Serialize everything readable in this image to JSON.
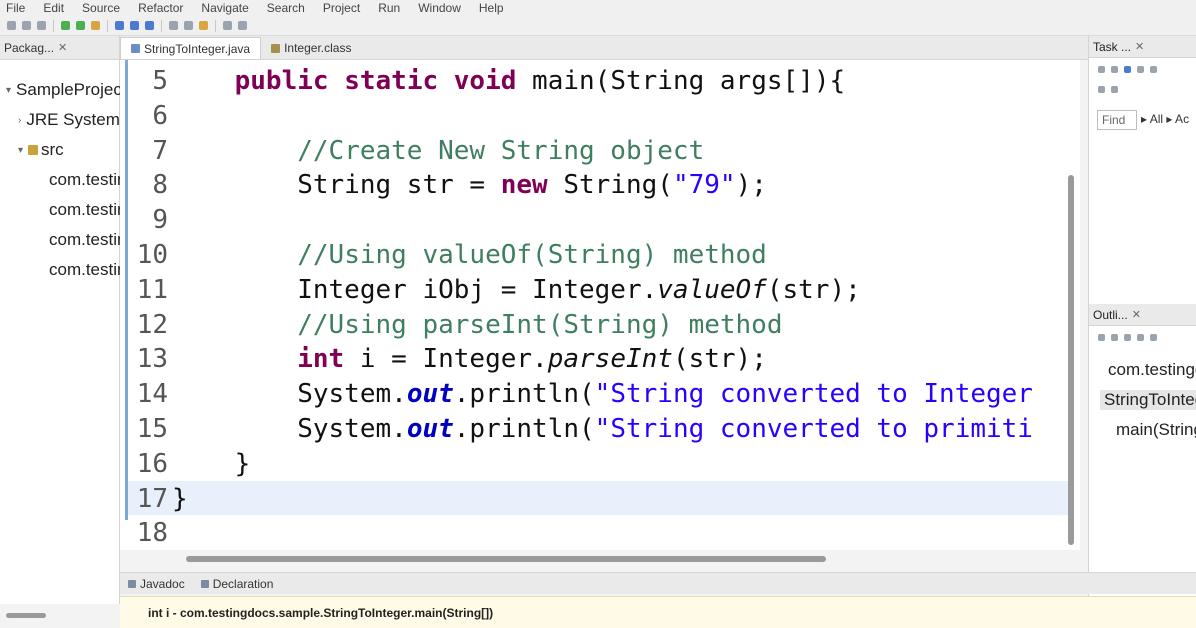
{
  "menu": [
    "File",
    "Edit",
    "Source",
    "Refactor",
    "Navigate",
    "Search",
    "Project",
    "Run",
    "Window",
    "Help"
  ],
  "package_explorer": {
    "title": "Packag...",
    "close": "✕",
    "items": [
      {
        "label": "SampleProject",
        "twisty": "▾",
        "icon": "project-icon"
      },
      {
        "label": "JRE System Library",
        "twisty": "›",
        "icon": "library-icon"
      },
      {
        "label": "src",
        "twisty": "▾",
        "icon": "source-folder-icon"
      },
      {
        "label": "com.testingdocs",
        "icon": "package-icon"
      },
      {
        "label": "com.testingdocs",
        "icon": "package-icon"
      },
      {
        "label": "com.testingdocs",
        "icon": "package-icon"
      },
      {
        "label": "com.testingdocs",
        "icon": "package-icon"
      }
    ]
  },
  "editor_tabs": [
    {
      "label": "StringToInteger.java",
      "active": true,
      "icon": "java-file-icon"
    },
    {
      "label": "Integer.class",
      "active": false,
      "icon": "class-file-icon"
    }
  ],
  "code": {
    "lines": [
      {
        "num": "5",
        "parts": [
          {
            "t": "    "
          },
          {
            "t": "public",
            "c": "kw"
          },
          {
            "t": " "
          },
          {
            "t": "static",
            "c": "kw"
          },
          {
            "t": " "
          },
          {
            "t": "void",
            "c": "kw"
          },
          {
            "t": " main(String args[]){"
          }
        ]
      },
      {
        "num": "6",
        "parts": [
          {
            "t": ""
          }
        ]
      },
      {
        "num": "7",
        "parts": [
          {
            "t": "        "
          },
          {
            "t": "//Create New String object",
            "c": "cm"
          }
        ]
      },
      {
        "num": "8",
        "parts": [
          {
            "t": "        String str = "
          },
          {
            "t": "new",
            "c": "kw"
          },
          {
            "t": " String("
          },
          {
            "t": "\"79\"",
            "c": "str"
          },
          {
            "t": ");"
          }
        ]
      },
      {
        "num": "9",
        "parts": [
          {
            "t": ""
          }
        ]
      },
      {
        "num": "10",
        "parts": [
          {
            "t": "        "
          },
          {
            "t": "//Using valueOf(String) method",
            "c": "cm"
          }
        ]
      },
      {
        "num": "11",
        "parts": [
          {
            "t": "        Integer iObj = Integer."
          },
          {
            "t": "valueOf",
            "c": "it"
          },
          {
            "t": "(str);"
          }
        ]
      },
      {
        "num": "12",
        "parts": [
          {
            "t": "        "
          },
          {
            "t": "//Using parseInt(String) method",
            "c": "cm"
          }
        ]
      },
      {
        "num": "13",
        "parts": [
          {
            "t": "        "
          },
          {
            "t": "int",
            "c": "kw"
          },
          {
            "t": " i = Integer."
          },
          {
            "t": "parseInt",
            "c": "it"
          },
          {
            "t": "(str);"
          }
        ]
      },
      {
        "num": "14",
        "parts": [
          {
            "t": "        System."
          },
          {
            "t": "out",
            "c": "st"
          },
          {
            "t": ".println("
          },
          {
            "t": "\"String converted to Integer",
            "c": "str"
          }
        ]
      },
      {
        "num": "15",
        "parts": [
          {
            "t": "        System."
          },
          {
            "t": "out",
            "c": "st"
          },
          {
            "t": ".println("
          },
          {
            "t": "\"String converted to primiti",
            "c": "str"
          }
        ]
      },
      {
        "num": "16",
        "parts": [
          {
            "t": "    }"
          }
        ]
      },
      {
        "num": "17",
        "parts": [
          {
            "t": "}"
          }
        ]
      },
      {
        "num": "18",
        "parts": [
          {
            "t": ""
          }
        ]
      }
    ]
  },
  "task_list": {
    "title": "Task ...",
    "close": "✕",
    "find_placeholder": "Find",
    "find_options": "▸ All ▸ Ac"
  },
  "outline": {
    "title": "Outli...",
    "close": "✕",
    "items": [
      {
        "label": "com.testingdocs",
        "icon": "package-icon"
      },
      {
        "label": "StringToInteger",
        "icon": "class-icon",
        "selected": true
      },
      {
        "label": "main(String[])",
        "icon": "method-icon"
      }
    ]
  },
  "bottom_tabs": [
    {
      "label": "Javadoc",
      "icon": "javadoc-icon"
    },
    {
      "label": "Declaration",
      "icon": "declaration-icon"
    }
  ],
  "status": "int i - com.testingdocs.sample.StringToInteger.main(String[])"
}
